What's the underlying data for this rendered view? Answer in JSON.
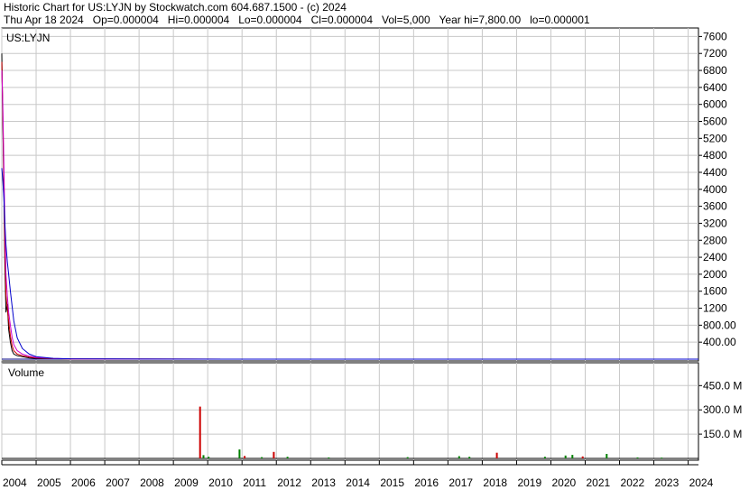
{
  "header": {
    "line1": "Historic Chart for US:LYJN by Stockwatch.com 604.687.1500 - (c) 2024",
    "line2": "Thu Apr 18 2024   Op=0.000004   Hi=0.000004   Lo=0.000004   Cl=0.000004   Vol=5,000   Year hi=7,800.00   lo=0.000001"
  },
  "colors": {
    "price": "#000000",
    "ma_short": "#cc0000",
    "ma_mid": "#cc00cc",
    "ma_long": "#0000cc",
    "vol_up": "#008000",
    "vol_down": "#cc0000",
    "grid": "#c8c8c8"
  },
  "chart_data": [
    {
      "type": "line",
      "title": "US:LYJN",
      "ylim": [
        0,
        7800
      ],
      "y_ticks": [
        "400.00",
        "800.00",
        "1200",
        "1600",
        "2000",
        "2400",
        "2800",
        "3200",
        "3600",
        "4000",
        "4400",
        "4800",
        "5200",
        "5600",
        "6000",
        "6400",
        "6800",
        "7200",
        "7600"
      ],
      "x_ticks": [
        "2004",
        "2005",
        "2006",
        "2007",
        "2008",
        "2009",
        "2010",
        "2011",
        "2012",
        "2013",
        "2014",
        "2015",
        "2016",
        "2017",
        "2018",
        "2019",
        "2020",
        "2021",
        "2022",
        "2023",
        "2024"
      ],
      "x": [
        2004.0,
        2004.03,
        2004.06,
        2004.09,
        2004.12,
        2004.16,
        2004.2,
        2004.25,
        2004.3,
        2004.35,
        2004.45,
        2004.6,
        2004.8,
        2005.0,
        2005.5,
        2006.0,
        2008.0,
        2012.0,
        2016.0,
        2020.0,
        2024.3
      ],
      "series": [
        {
          "key": "price",
          "values": [
            7200,
            5600,
            4000,
            2200,
            1100,
            1300,
            700,
            400,
            200,
            120,
            80,
            60,
            30,
            20,
            10,
            5,
            2,
            1,
            0.5,
            0.1,
            4e-06
          ]
        },
        {
          "key": "ma_short",
          "values": [
            7000,
            5800,
            4200,
            2600,
            1500,
            1200,
            900,
            550,
            320,
            200,
            120,
            80,
            50,
            30,
            12,
            6,
            2,
            1,
            0.5,
            0.1,
            4e-06
          ]
        },
        {
          "key": "ma_mid",
          "values": [
            6800,
            6000,
            4600,
            3200,
            2000,
            1500,
            1100,
            800,
            520,
            340,
            200,
            120,
            70,
            40,
            15,
            7,
            3,
            1,
            0.5,
            0.1,
            4e-06
          ]
        },
        {
          "key": "ma_long",
          "values": [
            4500,
            4200,
            3800,
            3200,
            2700,
            2300,
            2000,
            1600,
            1250,
            900,
            500,
            250,
            120,
            60,
            20,
            8,
            3,
            1,
            0.5,
            0.1,
            4e-06
          ]
        }
      ]
    },
    {
      "type": "bar",
      "title": "Volume",
      "ylim": [
        0,
        580
      ],
      "y_ticks": [
        "150.0 M",
        "300.0 M",
        "450.0 M"
      ],
      "x_ticks": [
        "2004",
        "2005",
        "2006",
        "2007",
        "2008",
        "2009",
        "2010",
        "2011",
        "2012",
        "2013",
        "2014",
        "2015",
        "2016",
        "2017",
        "2018",
        "2019",
        "2020",
        "2021",
        "2022",
        "2023",
        "2024"
      ],
      "bars": [
        {
          "x": 2009.75,
          "value": 320,
          "dir": "down"
        },
        {
          "x": 2009.85,
          "value": 20,
          "dir": "up"
        },
        {
          "x": 2010.0,
          "value": 10,
          "dir": "up"
        },
        {
          "x": 2010.9,
          "value": 55,
          "dir": "up"
        },
        {
          "x": 2011.05,
          "value": 15,
          "dir": "down"
        },
        {
          "x": 2011.55,
          "value": 8,
          "dir": "up"
        },
        {
          "x": 2011.9,
          "value": 40,
          "dir": "down"
        },
        {
          "x": 2012.3,
          "value": 10,
          "dir": "up"
        },
        {
          "x": 2013.5,
          "value": 6,
          "dir": "up"
        },
        {
          "x": 2015.8,
          "value": 8,
          "dir": "up"
        },
        {
          "x": 2017.3,
          "value": 14,
          "dir": "up"
        },
        {
          "x": 2017.6,
          "value": 10,
          "dir": "up"
        },
        {
          "x": 2018.4,
          "value": 35,
          "dir": "down"
        },
        {
          "x": 2019.8,
          "value": 10,
          "dir": "up"
        },
        {
          "x": 2020.4,
          "value": 18,
          "dir": "up"
        },
        {
          "x": 2020.6,
          "value": 22,
          "dir": "up"
        },
        {
          "x": 2020.9,
          "value": 12,
          "dir": "down"
        },
        {
          "x": 2021.6,
          "value": 28,
          "dir": "up"
        },
        {
          "x": 2022.5,
          "value": 6,
          "dir": "up"
        },
        {
          "x": 2023.2,
          "value": 5,
          "dir": "up"
        }
      ]
    }
  ]
}
